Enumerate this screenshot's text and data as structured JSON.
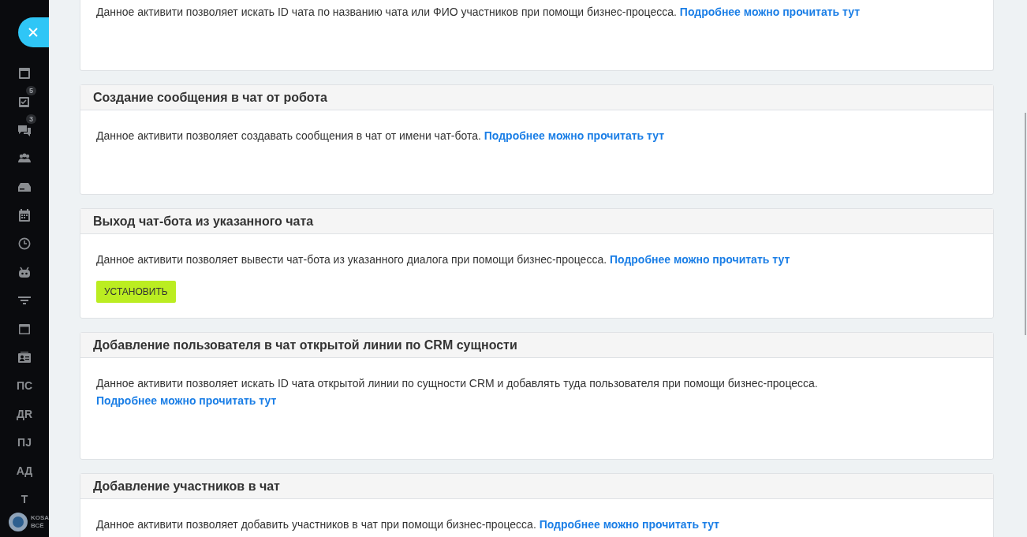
{
  "sidebar": {
    "icons": [
      {
        "kind": "feed"
      },
      {
        "kind": "tasks",
        "badge": "5"
      },
      {
        "kind": "chat",
        "badge": "3"
      },
      {
        "kind": "group"
      },
      {
        "kind": "drive"
      },
      {
        "kind": "calendar"
      },
      {
        "kind": "clock"
      },
      {
        "kind": "robot"
      },
      {
        "kind": "filter"
      },
      {
        "kind": "window"
      },
      {
        "kind": "contact"
      }
    ],
    "labels": [
      "ПС",
      "ДR",
      "ПJ",
      "АД",
      "Т"
    ],
    "logo": {
      "line_1": "KOSA",
      "line_2": "ВСЁ"
    }
  },
  "cards": [
    {
      "description": "Данное активити позволяет искать ID чата по названию чата или ФИО участников при помощи бизнес-процесса.",
      "link": "Подробнее можно прочитать тут"
    },
    {
      "title": "Создание сообщения в чат от робота",
      "description": "Данное активити позволяет создавать сообщения в чат от имени чат-бота.",
      "link": "Подробнее можно прочитать тут"
    },
    {
      "title": "Выход чат-бота из указанного чата",
      "description": "Данное активити позволяет вывести чат-бота из указанного диалога при помощи бизнес-процесса.",
      "link": "Подробнее можно прочитать тут",
      "button": "УСТАНОВИТЬ"
    },
    {
      "title": "Добавление пользователя в чат открытой линии по CRM сущности",
      "description": "Данное активити позволяет искать ID чата открытой линии по сущности CRM и добавлять туда пользователя при помощи бизнес-процесса.",
      "link": "Подробнее можно прочитать тут"
    },
    {
      "title": "Добавление участников в чат",
      "description": "Данное активити позволяет добавить участников в чат при помощи бизнес-процесса.",
      "link": "Подробнее можно прочитать тут"
    }
  ]
}
